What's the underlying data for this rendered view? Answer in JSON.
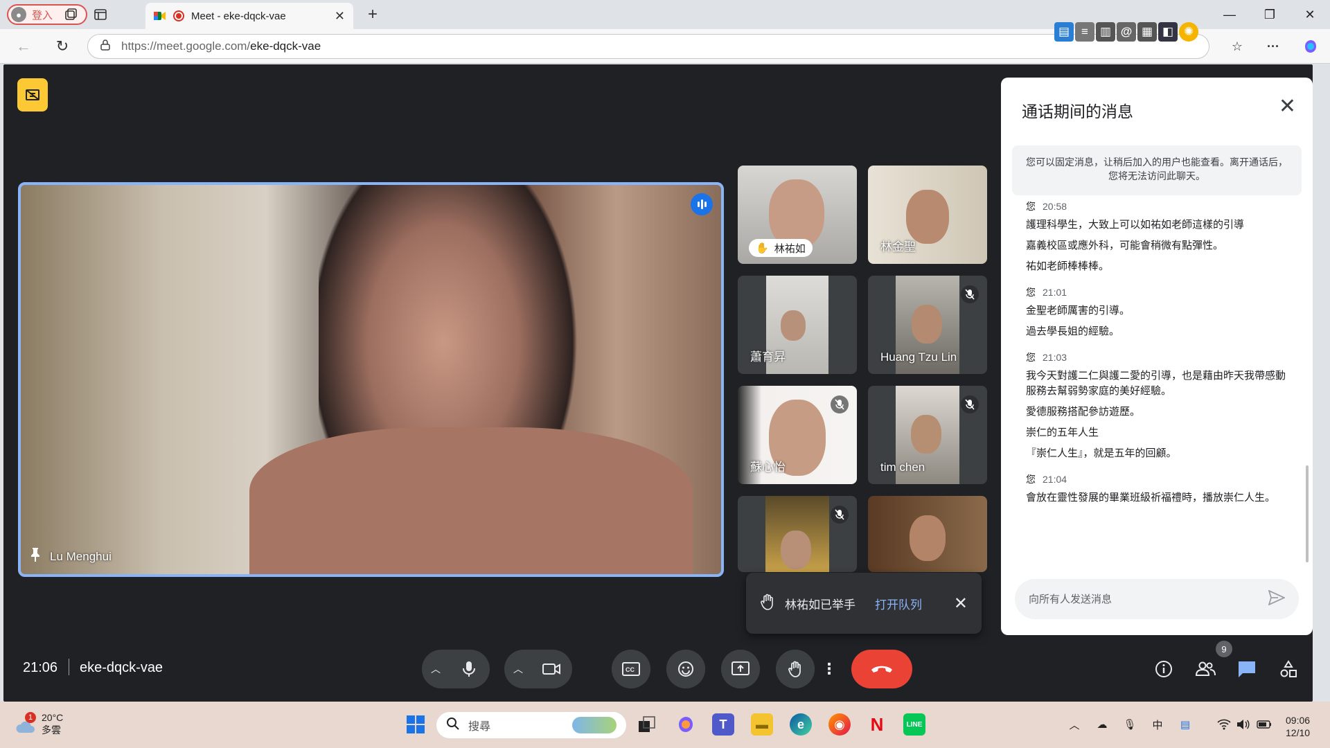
{
  "browser": {
    "profile_label": "登入",
    "tab_title": "Meet - eke-dqck-vae",
    "url_host": "https://meet.google.com/",
    "url_path": "eke-dqck-vae"
  },
  "meet": {
    "main_speaker": "Lu Menghui",
    "participants": [
      {
        "name": "林祐如",
        "hand_raised": true,
        "muted": false
      },
      {
        "name": "林金聖",
        "hand_raised": false,
        "muted": false
      },
      {
        "name": "蕭育昇",
        "hand_raised": false,
        "muted": false
      },
      {
        "name": "Huang Tzu Lin",
        "hand_raised": false,
        "muted": true
      },
      {
        "name": "蘇心怡",
        "hand_raised": false,
        "muted": true
      },
      {
        "name": "tim chen",
        "hand_raised": false,
        "muted": true
      },
      {
        "name": "",
        "hand_raised": false,
        "muted": true
      },
      {
        "name": "",
        "hand_raised": false,
        "muted": false
      }
    ],
    "toast": {
      "text": "林祐如已举手",
      "link": "打开队列"
    },
    "meeting_time": "21:06",
    "meeting_code": "eke-dqck-vae",
    "people_count": "9"
  },
  "chat": {
    "title": "通话期间的消息",
    "notice": "您可以固定消息，让稍后加入的用户也能查看。离开通话后，您将无法访问此聊天。",
    "messages": [
      {
        "sender": "您",
        "time": "20:58",
        "lines": [
          "護理科學生，大致上可以如祐如老師這樣的引導",
          "嘉義校區或應外科，可能會稍微有點彈性。",
          "祐如老師棒棒棒。"
        ]
      },
      {
        "sender": "您",
        "time": "21:01",
        "lines": [
          "金聖老師厲害的引導。",
          "過去學長姐的經驗。"
        ]
      },
      {
        "sender": "您",
        "time": "21:03",
        "lines": [
          "我今天對護二仁與護二愛的引導，也是藉由昨天我帶感動服務去幫弱勢家庭的美好經驗。",
          "愛德服務搭配參訪遊歷。",
          "崇仁的五年人生",
          "『崇仁人生』，就是五年的回顧。"
        ]
      },
      {
        "sender": "您",
        "time": "21:04",
        "lines": [
          "會放在靈性發展的畢業班級祈福禮時，播放崇仁人生。"
        ]
      }
    ],
    "composer_placeholder": "向所有人发送消息"
  },
  "taskbar": {
    "weather_badge": "1",
    "weather_temp": "20°C",
    "weather_desc": "多雲",
    "search_placeholder": "搜尋",
    "time": "09:06",
    "date": "12/10"
  }
}
